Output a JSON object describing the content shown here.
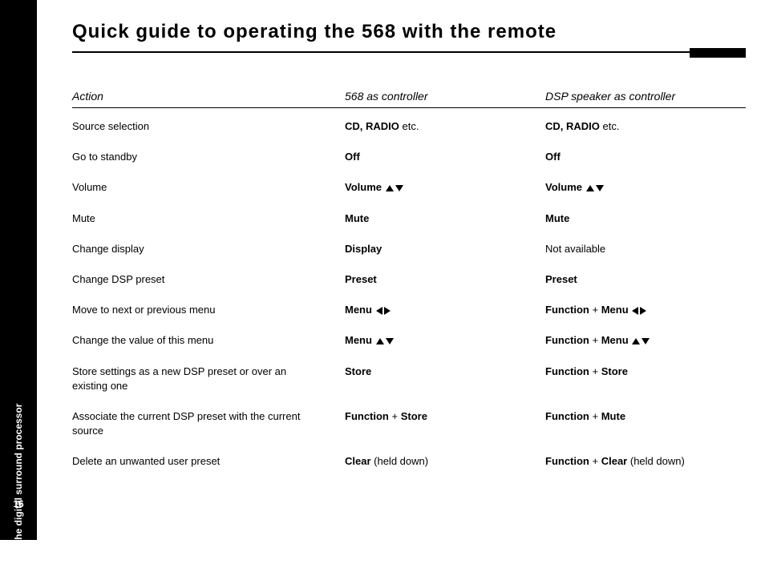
{
  "spine": {
    "section": "Using the digital surround processor",
    "page_number": "16"
  },
  "header": {
    "title": "Quick guide to operating the 568 with the remote"
  },
  "table": {
    "columns": {
      "action": "Action",
      "controller568": "568 as controller",
      "dsp": "DSP speaker as controller"
    },
    "rows": [
      {
        "action": "Source selection",
        "c568": [
          {
            "b": "CD, RADIO"
          },
          {
            "n": " etc."
          }
        ],
        "dsp": [
          {
            "b": "CD, RADIO"
          },
          {
            "n": " etc."
          }
        ]
      },
      {
        "action": "Go to standby",
        "c568": [
          {
            "b": "Off"
          }
        ],
        "dsp": [
          {
            "b": "Off"
          }
        ]
      },
      {
        "action": "Volume",
        "c568": [
          {
            "b": "Volume "
          },
          {
            "icon": "up"
          },
          {
            "icon": "down"
          }
        ],
        "dsp": [
          {
            "b": "Volume "
          },
          {
            "icon": "up"
          },
          {
            "icon": "down"
          }
        ]
      },
      {
        "action": "Mute",
        "c568": [
          {
            "b": "Mute"
          }
        ],
        "dsp": [
          {
            "b": "Mute"
          }
        ]
      },
      {
        "action": "Change display",
        "c568": [
          {
            "b": "Display"
          }
        ],
        "dsp": [
          {
            "n": "Not available"
          }
        ]
      },
      {
        "action": "Change DSP preset",
        "c568": [
          {
            "b": "Preset"
          }
        ],
        "dsp": [
          {
            "b": "Preset"
          }
        ]
      },
      {
        "action": "Move to next or previous menu",
        "c568": [
          {
            "b": "Menu "
          },
          {
            "icon": "left"
          },
          {
            "icon": "right"
          }
        ],
        "dsp": [
          {
            "b": "Function"
          },
          {
            "n": " + "
          },
          {
            "b": "Menu "
          },
          {
            "icon": "left"
          },
          {
            "icon": "right"
          }
        ]
      },
      {
        "action": "Change the value of this menu",
        "c568": [
          {
            "b": "Menu "
          },
          {
            "icon": "up"
          },
          {
            "icon": "down"
          }
        ],
        "dsp": [
          {
            "b": "Function"
          },
          {
            "n": " + "
          },
          {
            "b": "Menu "
          },
          {
            "icon": "up"
          },
          {
            "icon": "down"
          }
        ]
      },
      {
        "action": "Store settings as a new DSP preset or over an existing one",
        "c568": [
          {
            "b": "Store"
          }
        ],
        "dsp": [
          {
            "b": "Function"
          },
          {
            "n": " + "
          },
          {
            "b": "Store"
          }
        ]
      },
      {
        "action": "Associate the current DSP preset with the current source",
        "c568": [
          {
            "b": "Function"
          },
          {
            "n": " + "
          },
          {
            "b": "Store"
          }
        ],
        "dsp": [
          {
            "b": "Function"
          },
          {
            "n": " + "
          },
          {
            "b": "Mute"
          }
        ]
      },
      {
        "action": "Delete an unwanted user preset",
        "c568": [
          {
            "b": "Clear"
          },
          {
            "n": " (held down)"
          }
        ],
        "dsp": [
          {
            "b": "Function"
          },
          {
            "n": " + "
          },
          {
            "b": "Clear"
          },
          {
            "n": " (held down)"
          }
        ]
      }
    ]
  }
}
